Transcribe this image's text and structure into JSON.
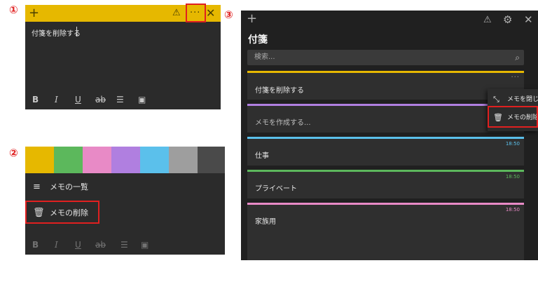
{
  "steps": {
    "one": "①",
    "two": "②",
    "three": "③"
  },
  "panel1": {
    "icons": {
      "new": "+",
      "warning": "⚠",
      "more": "···",
      "close": "✕"
    },
    "note_text": "付箋を削除する",
    "format": {
      "bold": "B",
      "italic": "I",
      "underline": "U",
      "strike": "ab",
      "list": "☰",
      "image": "▣"
    },
    "header_color": "#e6b800"
  },
  "panel2": {
    "swatches": [
      "#e6b800",
      "#5cb85c",
      "#e88ac6",
      "#b07fe0",
      "#5bc0eb",
      "#9e9e9e",
      "#4a4a4a"
    ],
    "menu": [
      {
        "icon": "≡",
        "label": "メモの一覧"
      },
      {
        "icon": "🗑",
        "label": "メモの削除"
      }
    ],
    "format": {
      "bold": "B",
      "italic": "I",
      "underline": "U",
      "strike": "ab",
      "list": "☰",
      "image": "▣"
    }
  },
  "panel3": {
    "icons": {
      "new": "+",
      "warning": "⚠",
      "settings": "⚙",
      "close": "✕",
      "search": "⌕",
      "more": "···"
    },
    "title": "付箋",
    "search_placeholder": "検索...",
    "notes": [
      {
        "label": "付箋を削除する",
        "color": "#e6b800",
        "time": ""
      },
      {
        "label": "メモを作成する...",
        "color": "#b07fe0",
        "time": ""
      },
      {
        "label": "仕事",
        "color": "#5bc0eb",
        "time": "18:50"
      },
      {
        "label": "プライベート",
        "color": "#5cb85c",
        "time": "18:50"
      },
      {
        "label": "家族用",
        "color": "#e88ac6",
        "time": "18:50"
      }
    ],
    "context_menu": [
      {
        "icon": "⤡",
        "label": "メモを閉じる"
      },
      {
        "icon": "🗑",
        "label": "メモの削除"
      }
    ]
  },
  "colors": {
    "highlight": "#e02020"
  }
}
